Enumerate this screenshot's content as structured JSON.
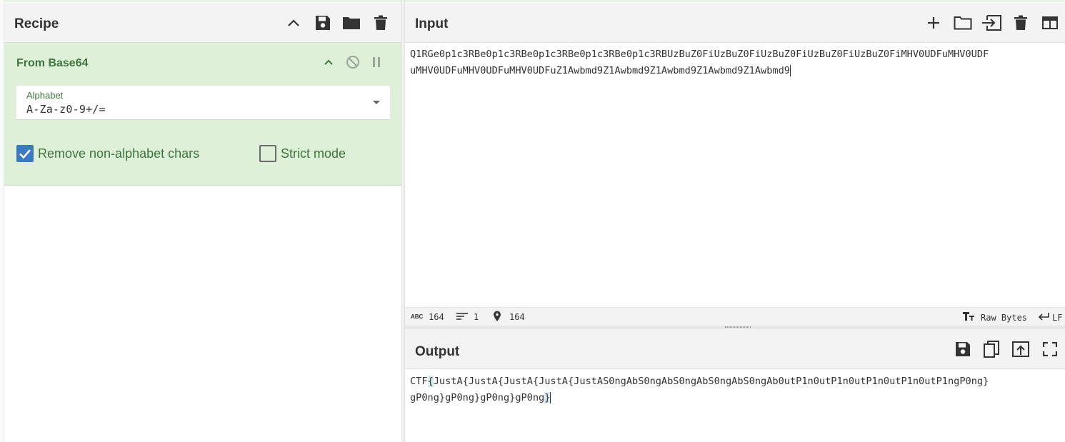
{
  "recipe": {
    "title": "Recipe",
    "operation": {
      "name": "From Base64",
      "alphabet_label": "Alphabet",
      "alphabet_value": "A-Za-z0-9+/=",
      "remove_nonalpha_label": "Remove non-alphabet chars",
      "remove_nonalpha_checked": true,
      "strict_mode_label": "Strict mode",
      "strict_mode_checked": false
    },
    "toolbar_icons": [
      "chevron-up-icon",
      "save-icon",
      "folder-icon",
      "trash-icon"
    ]
  },
  "input": {
    "title": "Input",
    "line1": "Q1RGe0p1c3RBe0p1c3RBe0p1c3RBe0p1c3RBe0p1c3RBUzBuZ0FiUzBuZ0FiUzBuZ0FiUzBuZ0FiUzBuZ0FiMHV0UDFuMHV0UDF",
    "line2": "uMHV0UDFuMHV0UDFuMHV0UDFuZ1Awbmd9Z1Awbmd9Z1Awbmd9Z1Awbmd9Z1Awbmd9",
    "toolbar_icons": [
      "plus-icon",
      "folder-icon",
      "import-icon",
      "trash-icon",
      "layout-icon"
    ],
    "status": {
      "length_icon": "ABC",
      "length": "164",
      "lines": "1",
      "position": "164",
      "encoding": "Raw Bytes",
      "eol": "LF"
    }
  },
  "output": {
    "title": "Output",
    "prefix": "CTF",
    "brace_open": "{",
    "line1_body": "JustA{JustA{JustA{JustA{JustAS0ngAbS0ngAbS0ngAbS0ngAbS0ngAb0utP1n0utP1n0utP1n0utP1n0utP1ngP0ng}",
    "line2_body": "gP0ng}gP0ng}gP0ng}gP0ng",
    "brace_close": "}",
    "toolbar_icons": [
      "save-icon",
      "copy-icon",
      "replace-input-icon",
      "maximize-icon"
    ]
  },
  "colors": {
    "operation_bg": "#dff0d8",
    "operation_text": "#3c763d",
    "checkbox_blue": "#3b78c4",
    "header_bg": "#f3f3f3"
  }
}
